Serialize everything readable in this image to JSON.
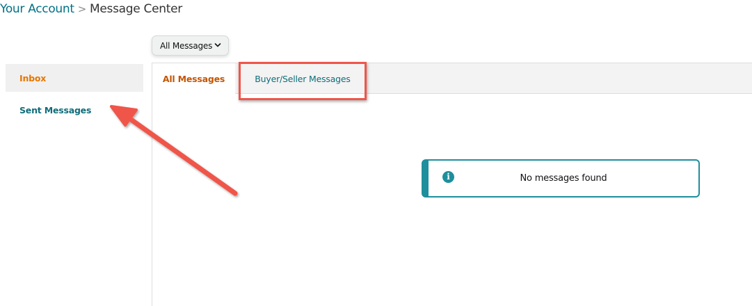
{
  "breadcrumb": {
    "parent": "Your Account",
    "separator": ">",
    "current": "Message Center"
  },
  "filter_dropdown": {
    "selected": "All Messages",
    "icon": "chevron-down-icon"
  },
  "sidebar": {
    "items": [
      {
        "label": "Inbox",
        "active": true
      },
      {
        "label": "Sent Messages",
        "active": false
      }
    ]
  },
  "tabs": [
    {
      "label": "All Messages",
      "active": true
    },
    {
      "label": "Buyer/Seller Messages",
      "active": false
    }
  ],
  "alert": {
    "icon": "info-icon",
    "icon_glyph": "i",
    "text": "No messages found"
  },
  "annotations": {
    "highlight_target": "Buyer/Seller Messages",
    "arrow_target": "Sent Messages",
    "annotation_color": "#f0554a"
  },
  "colors": {
    "link": "#007185",
    "active_orange": "#e77600",
    "tab_active": "#c45500",
    "teal": "#1e8f9c"
  }
}
